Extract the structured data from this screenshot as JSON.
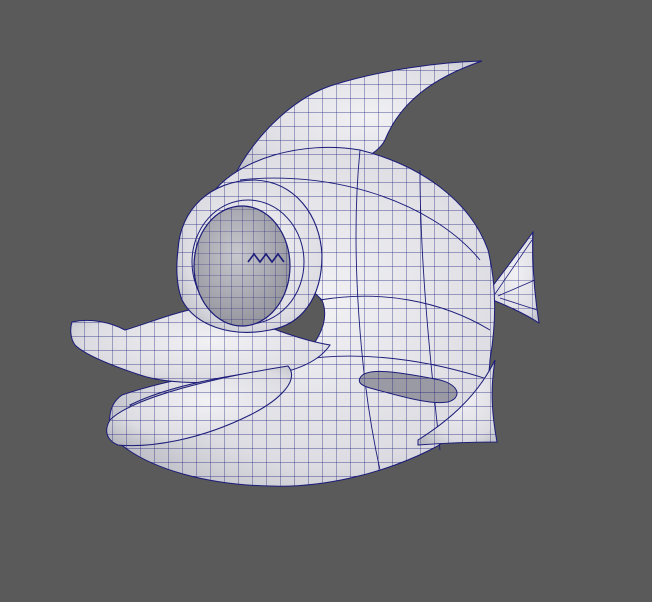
{
  "viewport": {
    "background": "#5a5a5a",
    "shading": "smooth-shaded-with-wireframe",
    "model": {
      "subject": "fish-icon",
      "surface_color": "#e8e8ec",
      "shadow_color": "#c9c9d0",
      "wire_color": "#1c1c7a"
    }
  }
}
